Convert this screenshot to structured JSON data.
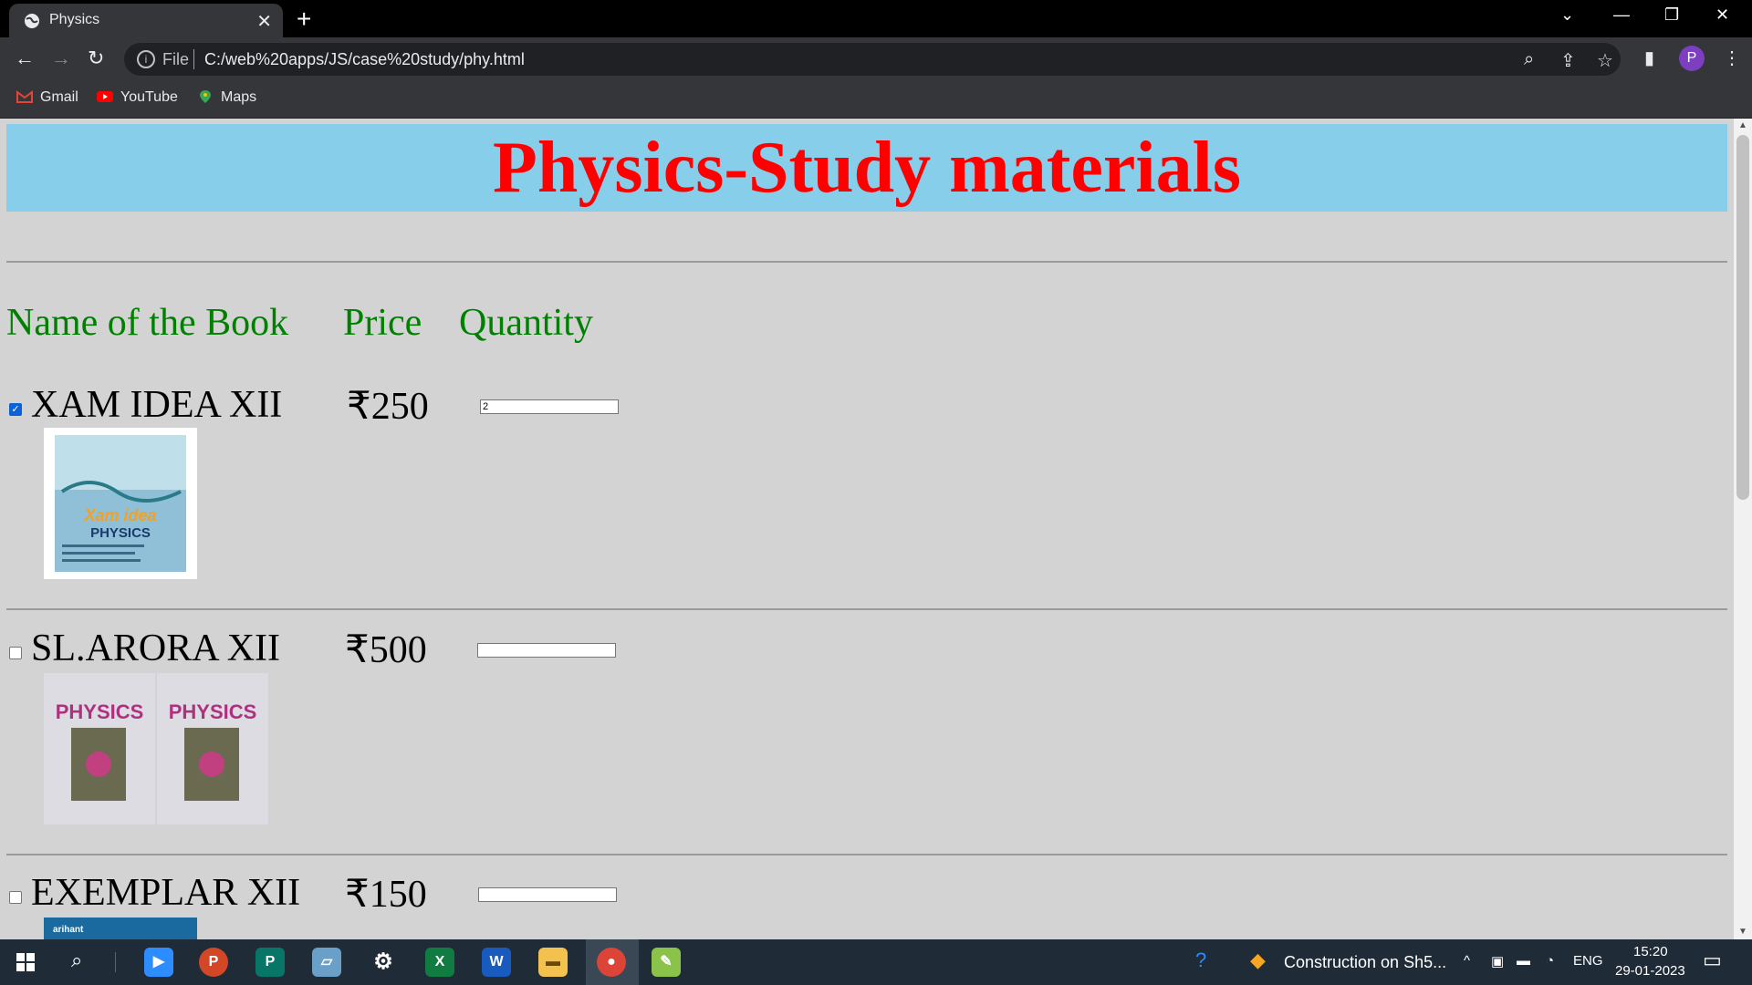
{
  "browser": {
    "tab_title": "Physics",
    "address_scheme": "File",
    "address_url": "C:/web%20apps/JS/case%20study/phy.html",
    "profile_initial": "P",
    "bookmarks": [
      "Gmail",
      "YouTube",
      "Maps"
    ]
  },
  "page": {
    "heading": "Physics-Study materials",
    "heading_color": "#ff0000",
    "banner_color": "#87ceeb",
    "columns": {
      "name": "Name of the Book",
      "price": "Price",
      "quantity": "Quantity"
    },
    "books": [
      {
        "name": "XAM IDEA XII",
        "price": "₹250",
        "checked": true,
        "quantity": "2",
        "cover_texts": [
          "Xam idea",
          "PHYSICS"
        ]
      },
      {
        "name": "SL.ARORA XII",
        "price": "₹500",
        "checked": false,
        "quantity": "",
        "cover_texts": [
          "PHYSICS",
          "PHYSICS"
        ]
      },
      {
        "name": "EXEMPLAR XII",
        "price": "₹150",
        "checked": false,
        "quantity": "",
        "cover_texts": [
          "arihant"
        ]
      }
    ]
  },
  "taskbar": {
    "notification": "Construction on Sh5...",
    "language": "ENG",
    "time": "15:20",
    "date": "29-01-2023",
    "apps": [
      "windows-start",
      "search",
      "zoom",
      "powerpoint",
      "publisher",
      "notepad",
      "settings",
      "excel",
      "word",
      "file-explorer",
      "chrome",
      "pentool"
    ]
  }
}
